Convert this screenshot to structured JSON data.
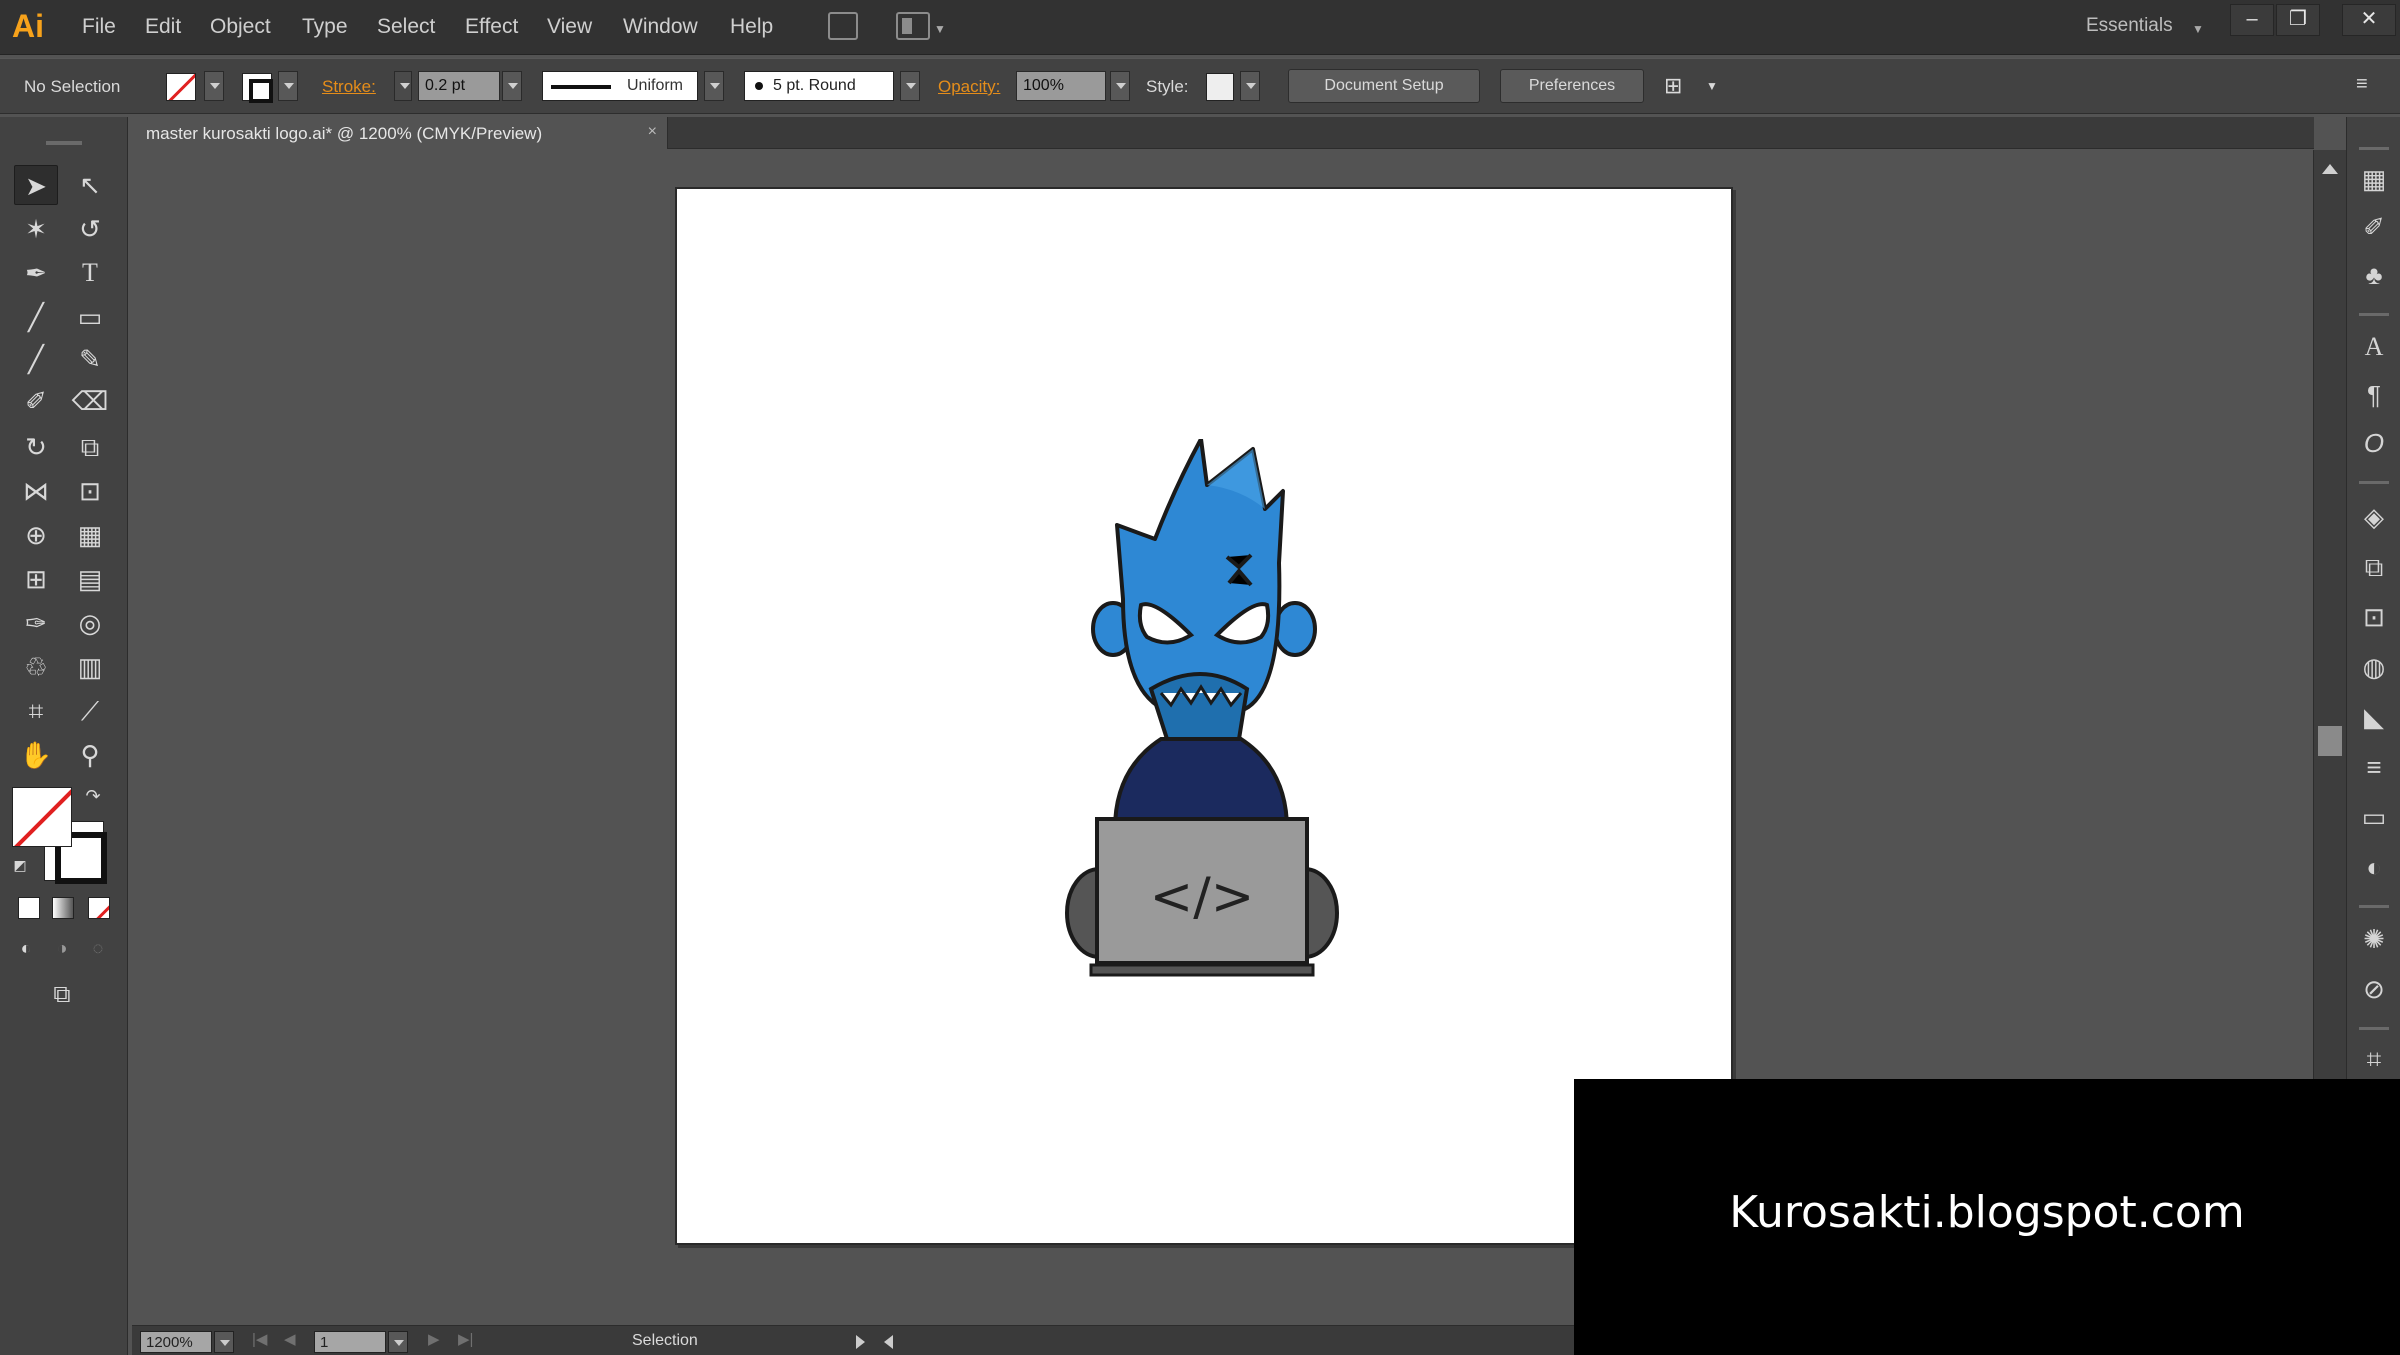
{
  "app": {
    "logo": "Ai",
    "workspace": "Essentials"
  },
  "menu": {
    "items": [
      "File",
      "Edit",
      "Object",
      "Type",
      "Select",
      "Effect",
      "View",
      "Window",
      "Help"
    ]
  },
  "window_controls": {
    "minimize": "–",
    "restore": "❐",
    "close": "✕"
  },
  "control_bar": {
    "selection_label": "No Selection",
    "stroke_label": "Stroke:",
    "stroke_weight": "0.2 pt",
    "variable_width": "Uniform",
    "brush": "5 pt. Round",
    "opacity_label": "Opacity:",
    "opacity_value": "100%",
    "style_label": "Style:",
    "document_setup": "Document Setup",
    "preferences": "Preferences"
  },
  "document_tab": {
    "title": "master kurosakti logo.ai* @ 1200% (CMYK/Preview)",
    "close": "×"
  },
  "artwork": {
    "code_symbol": "</>"
  },
  "tools": {
    "items": [
      "selection-tool",
      "direct-selection-tool",
      "magic-wand-tool",
      "lasso-tool",
      "pen-tool",
      "type-tool",
      "line-segment-tool",
      "rectangle-tool",
      "paintbrush-tool",
      "pencil-tool",
      "blob-brush-tool",
      "eraser-tool",
      "rotate-tool",
      "scale-tool",
      "width-tool",
      "free-transform-tool",
      "shape-builder-tool",
      "perspective-grid-tool",
      "mesh-tool",
      "gradient-tool",
      "eyedropper-tool",
      "blend-tool",
      "symbol-sprayer-tool",
      "column-graph-tool",
      "artboard-tool",
      "slice-tool",
      "hand-tool",
      "zoom-tool"
    ]
  },
  "right_dock": {
    "icons": [
      "swatches-panel-icon",
      "brushes-panel-icon",
      "symbols-panel-icon",
      "character-panel-icon",
      "paragraph-panel-icon",
      "opentype-panel-icon",
      "layers-panel-icon",
      "artboards-panel-icon",
      "transform-panel-icon",
      "appearance-panel-icon",
      "graphic-styles-panel-icon",
      "stroke-panel-icon",
      "gradient-panel-icon",
      "transparency-panel-icon",
      "color-guide-panel-icon",
      "links-panel-icon",
      "align-panel-icon"
    ]
  },
  "status_bar": {
    "zoom": "1200%",
    "artboard_number": "1",
    "tool_name": "Selection"
  },
  "watermark": {
    "text": "Kurosakti.blogspot.com"
  },
  "colors": {
    "ui_dark": "#323232",
    "ui_panel": "#424242",
    "canvas": "#535353",
    "accent_orange": "#f7a21b",
    "mascot_blue": "#2e88d4",
    "mascot_navy": "#1b2a5e",
    "laptop_gray": "#9a9a9a"
  }
}
